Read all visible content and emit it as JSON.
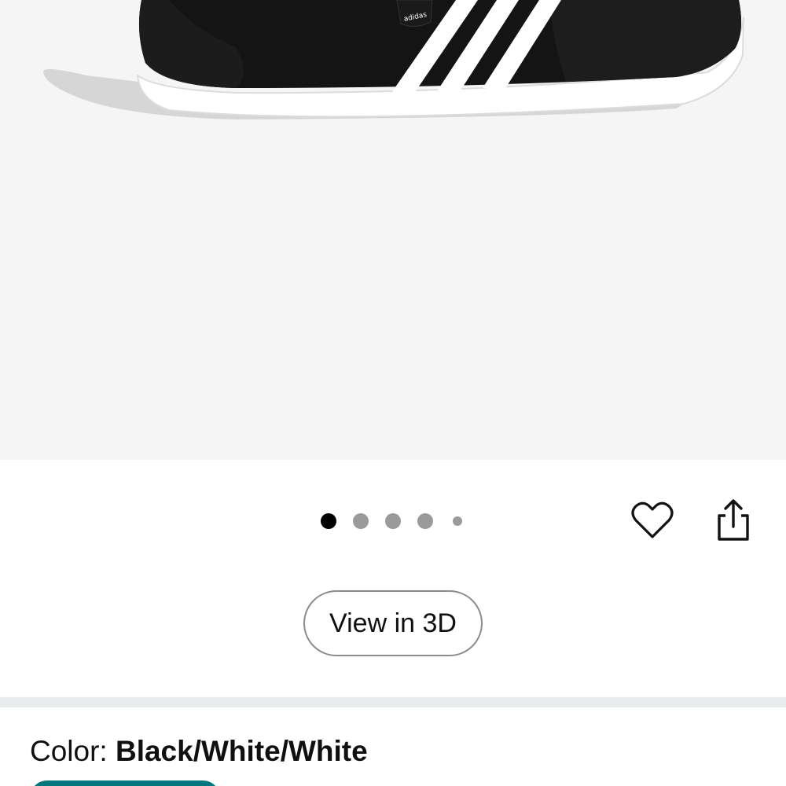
{
  "product_image": {
    "alt": "Black adidas shoe with three white stripes",
    "brand_tab": "adidas"
  },
  "gallery": {
    "dot_count": 5,
    "active_index": 0
  },
  "actions": {
    "favorite_icon": "heart-outline-icon",
    "share_icon": "share-icon"
  },
  "view3d": {
    "label": "View in 3D"
  },
  "color": {
    "label": "Color: ",
    "value": "Black/White/White"
  },
  "colors": {
    "image_bg": "#f5f5f5",
    "accent_teal": "#00767d",
    "dot_active": "#000000",
    "dot_inactive": "#9a9a9a"
  }
}
